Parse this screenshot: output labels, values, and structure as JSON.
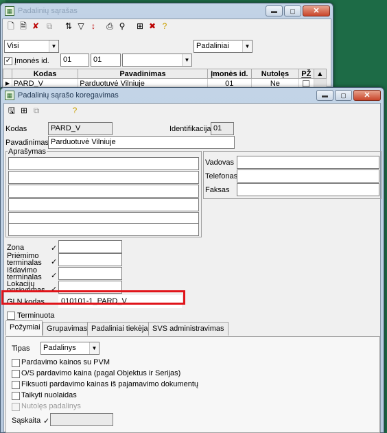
{
  "list_window": {
    "title": "Padalinių sąrašas",
    "filter1": "Visi",
    "filter2": "Padaliniai",
    "company_checkbox_label": "Įmonės id.",
    "company_checkbox_checked": true,
    "company_id_from": "01",
    "company_id_to": "01",
    "columns": [
      "Kodas",
      "Pavadinimas",
      "Įmonės id.",
      "Nutolęs",
      "PŽ"
    ],
    "rows": [
      {
        "kodas": "PARD_V",
        "pavadinimas": "Parduotuvė Vilniuje",
        "imones_id": "01",
        "nutoles": "Ne"
      }
    ]
  },
  "edit_window": {
    "title": "Padalinių sąrašo koregavimas",
    "kodas_label": "Kodas",
    "kodas_value": "PARD_V",
    "identifikacija_label": "Identifikacija",
    "identifikacija_value": "01",
    "pavadinimas_label": "Pavadinimas",
    "pavadinimas_value": "Parduotuvė Vilniuje",
    "aprasymas_label": "Aprašymas",
    "vadovas_label": "Vadovas",
    "telefonas_label": "Telefonas",
    "faksas_label": "Faksas",
    "zona_label": "Zona",
    "priemimo_label_1": "Priėmimo",
    "priemimo_label_2": "terminalas",
    "isdavimo_label_1": "Išdavimo",
    "isdavimo_label_2": "terminalas",
    "lokaciju_label_1": "Lokacijų",
    "lokaciju_label_2": "priskyrimas",
    "gln_label": "GLN kodas",
    "gln_value": "010101-1_PARD_V",
    "terminuota_label": "Terminuota",
    "tabs": [
      "Požymiai",
      "Grupavimas",
      "Padaliniai tiekėjai",
      "SVS administravimas"
    ],
    "active_tab": "Požymiai",
    "tipas_label": "Tipas",
    "tipas_value": "Padalinys",
    "checkboxes": [
      {
        "label": "Pardavimo kainos su PVM",
        "checked": false,
        "disabled": false
      },
      {
        "label": "O/S pardavimo kaina (pagal Objektus ir Serijas)",
        "checked": false,
        "disabled": false
      },
      {
        "label": "Fiksuoti pardavimo kainas iš pajamavimo dokumentų",
        "checked": false,
        "disabled": false
      },
      {
        "label": "Taikyti nuolaidas",
        "checked": false,
        "disabled": false
      },
      {
        "label": "Nutolęs padalinys",
        "checked": false,
        "disabled": true
      }
    ],
    "saskaita_label": "Sąskaita"
  },
  "colors": {
    "highlight": "#e0141a",
    "desktop": "#1d6b46"
  }
}
